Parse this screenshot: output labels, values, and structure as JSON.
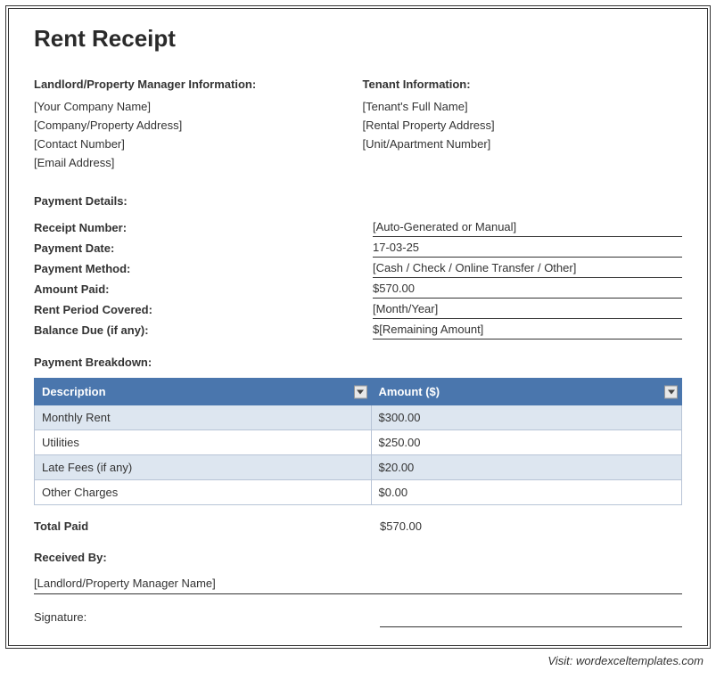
{
  "title": "Rent Receipt",
  "landlord": {
    "heading": "Landlord/Property Manager Information:",
    "company": "[Your Company Name]",
    "address": " [Company/Property Address]",
    "contact": "[Contact Number]",
    "email": "[Email Address]"
  },
  "tenant": {
    "heading": "Tenant Information:",
    "name": "[Tenant's Full Name]",
    "address": "[Rental Property Address]",
    "unit": "[Unit/Apartment Number]"
  },
  "payment": {
    "heading": "Payment Details:",
    "rows": [
      {
        "label": "Receipt Number:",
        "value": "[Auto-Generated or Manual]"
      },
      {
        "label": "Payment Date:",
        "value": "17-03-25"
      },
      {
        "label": "Payment Method:",
        "value": "[Cash / Check / Online Transfer / Other]"
      },
      {
        "label": "Amount Paid:",
        "value": "$570.00"
      },
      {
        "label": "Rent Period Covered:",
        "value": "[Month/Year]"
      },
      {
        "label": "Balance Due (if any):",
        "value": "$[Remaining Amount]"
      }
    ]
  },
  "breakdown": {
    "heading": "Payment Breakdown:",
    "columns": {
      "desc": "Description",
      "amount": "Amount ($)"
    },
    "rows": [
      {
        "desc": "Monthly Rent",
        "amount": "$300.00"
      },
      {
        "desc": "Utilities",
        "amount": "$250.00"
      },
      {
        "desc": "Late Fees (if any)",
        "amount": "$20.00"
      },
      {
        "desc": "Other Charges",
        "amount": "$0.00"
      }
    ],
    "total_label": "Total Paid",
    "total_value": "$570.00"
  },
  "received": {
    "heading": "Received By:",
    "name": "[Landlord/Property Manager Name]",
    "sig_label": "Signature:"
  },
  "footer": "Visit: wordexceltemplates.com"
}
